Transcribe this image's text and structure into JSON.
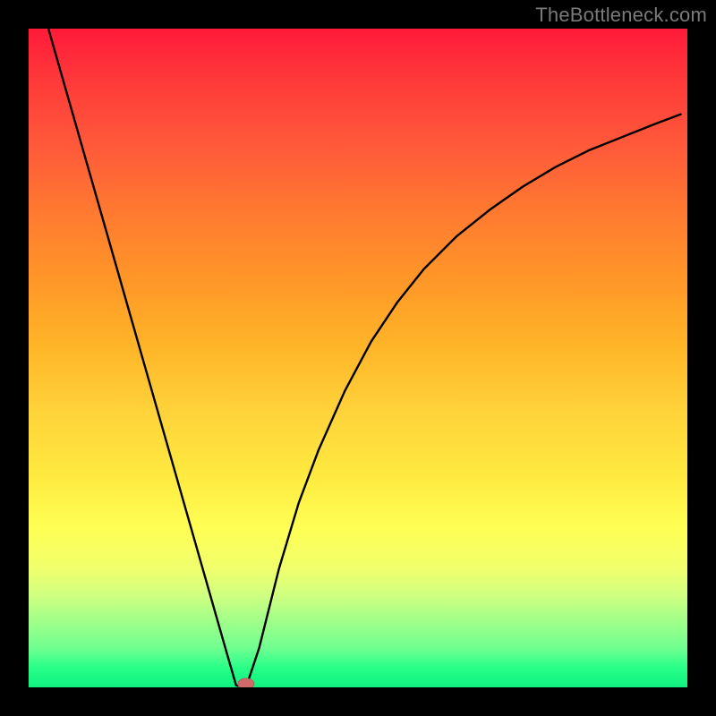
{
  "attribution": "TheBottleneck.com",
  "colors": {
    "bg": "#000000",
    "curve": "#000000",
    "marker_fill": "#d06a6a",
    "marker_stroke": "#c05a5a"
  },
  "chart_data": {
    "type": "line",
    "title": "",
    "xlabel": "",
    "ylabel": "",
    "xlim": [
      0,
      100
    ],
    "ylim": [
      0,
      100
    ],
    "grid": false,
    "series": [
      {
        "name": "bottleneck-curve",
        "x": [
          3.0,
          6.0,
          9.0,
          12.0,
          15.0,
          18.0,
          21.0,
          24.0,
          27.0,
          30.0,
          31.5,
          33.0,
          35.0,
          38.0,
          41.0,
          44.0,
          48.0,
          52.0,
          56.0,
          60.0,
          65.0,
          70.0,
          75.0,
          80.0,
          85.0,
          90.0,
          95.0,
          99.0
        ],
        "values": [
          100.0,
          89.5,
          79.0,
          68.5,
          58.0,
          47.5,
          37.0,
          26.5,
          16.0,
          5.5,
          0.3,
          0.0,
          6.0,
          18.0,
          28.0,
          36.0,
          45.0,
          52.5,
          58.5,
          63.5,
          68.5,
          72.5,
          76.0,
          79.0,
          81.5,
          83.5,
          85.5,
          87.0
        ]
      }
    ],
    "marker": {
      "x": 33.0,
      "y": 0.0
    }
  }
}
